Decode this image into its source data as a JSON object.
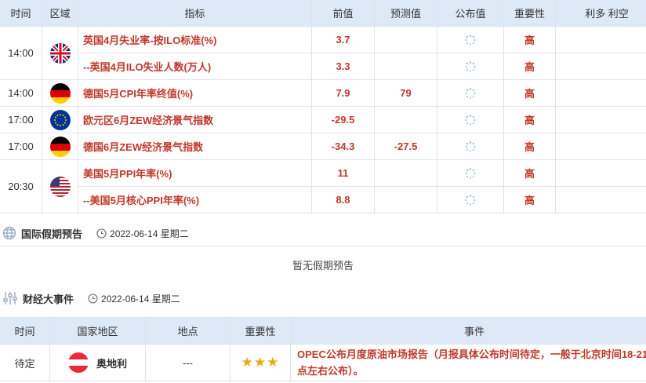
{
  "calendar": {
    "headers": [
      "时间",
      "区域",
      "指标",
      "前值",
      "预测值",
      "公布值",
      "重要性",
      "利多 利空"
    ],
    "rows": [
      {
        "time": "14:00",
        "indicator": "英国4月失业率-按ILO标准(%)",
        "prev": "3.7",
        "forecast": "",
        "importance": "高"
      },
      {
        "time": "",
        "indicator": "--英国4月ILO失业人数(万人)",
        "prev": "3.3",
        "forecast": "",
        "importance": "高"
      },
      {
        "time": "14:00",
        "indicator": "德国5月CPI年率终值(%)",
        "prev": "7.9",
        "forecast": "79",
        "importance": "高"
      },
      {
        "time": "17:00",
        "indicator": "欧元区6月ZEW经济景气指数",
        "prev": "-29.5",
        "forecast": "",
        "importance": "高"
      },
      {
        "time": "17:00",
        "indicator": "德国6月ZEW经济景气指数",
        "prev": "-34.3",
        "forecast": "-27.5",
        "importance": "高"
      },
      {
        "time": "20:30",
        "indicator": "美国5月PPI年率(%)",
        "prev": "11",
        "forecast": "",
        "importance": "高"
      },
      {
        "time": "",
        "indicator": "--美国5月核心PPI年率(%)",
        "prev": "8.8",
        "forecast": "",
        "importance": "高"
      }
    ]
  },
  "holidays": {
    "title": "国际假期预告",
    "date": "2022-06-14 星期二",
    "empty": "暂无假期预告"
  },
  "events": {
    "title": "财经大事件",
    "date": "2022-06-14 星期二",
    "headers": [
      "时间",
      "国家地区",
      "地点",
      "重要性",
      "事件"
    ],
    "rows": [
      {
        "time": "待定",
        "country": "奥地利",
        "place": "---",
        "stars": "★★★",
        "event": "OPEC公布月度原油市场报告（月报具体公布时间待定，一般于北京时间18-21点左右公布）。"
      }
    ]
  },
  "colors": {
    "accent": "#c0392b",
    "header_bg": "#dde9f7",
    "star": "#f0a817"
  }
}
